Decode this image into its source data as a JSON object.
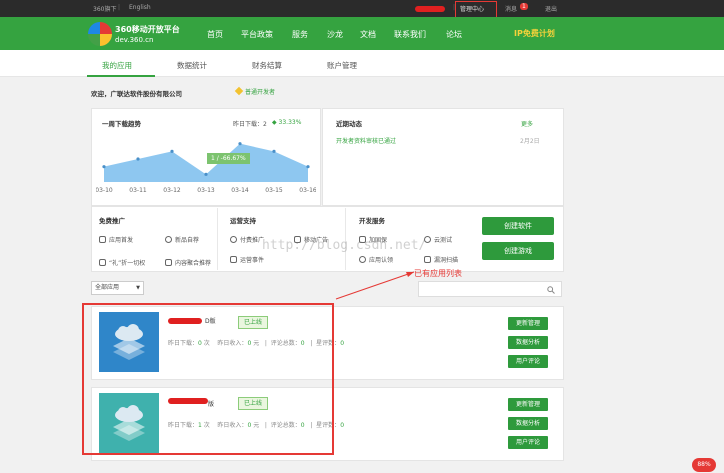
{
  "topbar": {
    "link_360": "360旗下",
    "link_english": "English",
    "admin_center": "管理中心",
    "messages": "消息",
    "messages_count": "1",
    "logout": "退出"
  },
  "brand": {
    "title": "360移动开放平台",
    "domain": "dev.360.cn"
  },
  "mainnav": {
    "items": [
      "首页",
      "平台政策",
      "服务",
      "沙龙",
      "文档",
      "联系我们",
      "论坛"
    ],
    "ip_plan": "IP免费计划"
  },
  "subnav": {
    "tabs": [
      "我的应用",
      "数据统计",
      "财务结算",
      "账户管理"
    ]
  },
  "welcome": {
    "text": "欢迎，广联达软件股份有限公司",
    "badge": "普通开发者"
  },
  "downloads": {
    "title": "一周下载趋势",
    "yesterday_label": "昨日下载：2",
    "growth": "33.33%",
    "tooltip": "1 / -66.67%"
  },
  "chart_data": {
    "type": "area",
    "categories": [
      "03-10",
      "03-11",
      "03-12",
      "03-13",
      "03-14",
      "03-15",
      "03-16"
    ],
    "values": [
      2,
      3,
      4,
      1,
      5,
      4,
      2
    ],
    "ylim": [
      0,
      6
    ],
    "color": "#8ec7f0"
  },
  "news": {
    "title": "近期动态",
    "more": "更多",
    "item_text": "开发者资料审核已通过",
    "item_date": "2月2日"
  },
  "promo": {
    "free_title": "免费推广",
    "free_items": [
      "应用首发",
      "新品自荐",
      "“礼”折一切权",
      "内容聚合推荐"
    ],
    "op_title": "运营支持",
    "op_items": [
      "付费推广",
      "移动广告",
      "运营事件"
    ],
    "dev_title": "开发服务",
    "dev_items": [
      "加固保",
      "云测试",
      "应用认领",
      "漏洞扫描"
    ],
    "create_app": "创建软件",
    "create_game": "创建游戏"
  },
  "filter": {
    "selected": "全部应用",
    "list_annotation": "已有应用列表"
  },
  "apps": [
    {
      "name_suffix": "D版",
      "status": "已上线",
      "yesterday_downloads_label": "昨日下载：",
      "yesterday_downloads": "0",
      "downloads_unit": "次",
      "yesterday_income_label": "昨日收入：",
      "yesterday_income": "0",
      "income_unit": "元",
      "reviews_label": "评论总数：",
      "reviews": "0",
      "rating_label": "星评数：",
      "rating": "0",
      "btn_update": "更新管理",
      "btn_data": "数据分析",
      "btn_reviews": "用户评论",
      "icon_color": "#2f86c9"
    },
    {
      "name_suffix": "版",
      "status": "已上线",
      "yesterday_downloads_label": "昨日下载：",
      "yesterday_downloads": "1",
      "downloads_unit": "次",
      "yesterday_income_label": "昨日收入：",
      "yesterday_income": "0",
      "income_unit": "元",
      "reviews_label": "评论总数：",
      "reviews": "0",
      "rating_label": "星评数：",
      "rating": "0",
      "btn_update": "更新管理",
      "btn_data": "数据分析",
      "btn_reviews": "用户评论",
      "icon_color": "#3fb1ad"
    }
  ],
  "watermark": "http://blog.csdn.net/",
  "perf_badge": "88%"
}
